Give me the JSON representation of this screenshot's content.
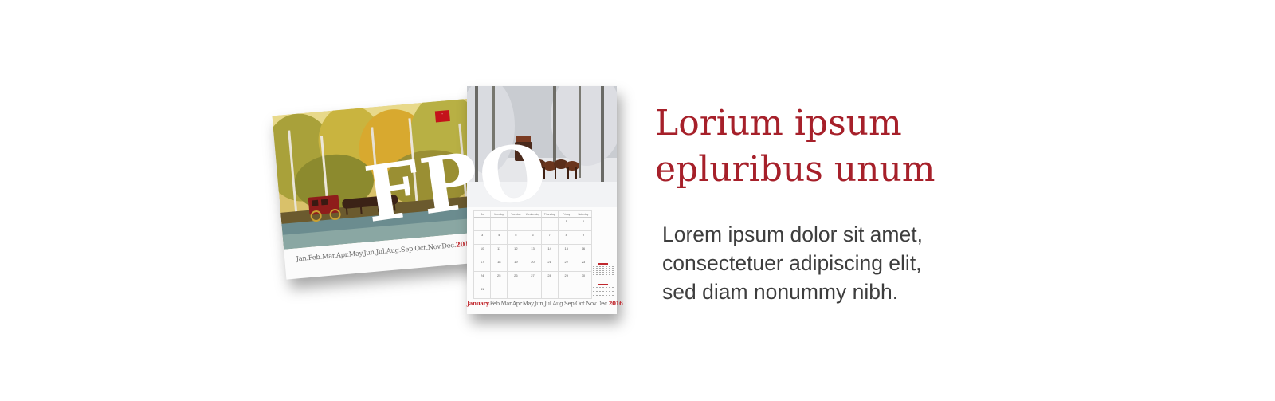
{
  "colors": {
    "headline": "#a6202a",
    "body_text": "#3e3e3e",
    "accent_red": "#c0272d",
    "background": "#ffffff"
  },
  "watermark": {
    "text": "FPO"
  },
  "calendar_front": {
    "months": "Jan.Feb.Mar.Apr.May.Jun.Jul.Aug.Sep.Oct.Nov.Dec.",
    "year": "2016"
  },
  "calendar_month": {
    "weekdays": [
      "Su",
      "Monday",
      "Tuesday",
      "Wednesday",
      "Thursday",
      "Friday",
      "Saturday"
    ],
    "days": [
      "",
      "",
      "",
      "",
      "",
      "1",
      "2",
      "3",
      "4",
      "5",
      "6",
      "7",
      "8",
      "9",
      "10",
      "11",
      "12",
      "13",
      "14",
      "15",
      "16",
      "17",
      "18",
      "19",
      "20",
      "21",
      "22",
      "23",
      "24",
      "25",
      "26",
      "27",
      "28",
      "29",
      "30",
      "31",
      "",
      "",
      "",
      "",
      "",
      ""
    ],
    "current_month": "January.",
    "other_months": "Feb.Mar.Apr.May.Jun.Jul.Aug.Sep.Oct.Nov.Dec.",
    "year": "2016"
  },
  "headline": {
    "line1": "Lorium ipsum",
    "line2": "epluribus unum"
  },
  "body": {
    "line1": "Lorem ipsum dolor sit amet,",
    "line2": "consectetuer adipiscing elit,",
    "line3": "sed diam nonummy nibh."
  }
}
